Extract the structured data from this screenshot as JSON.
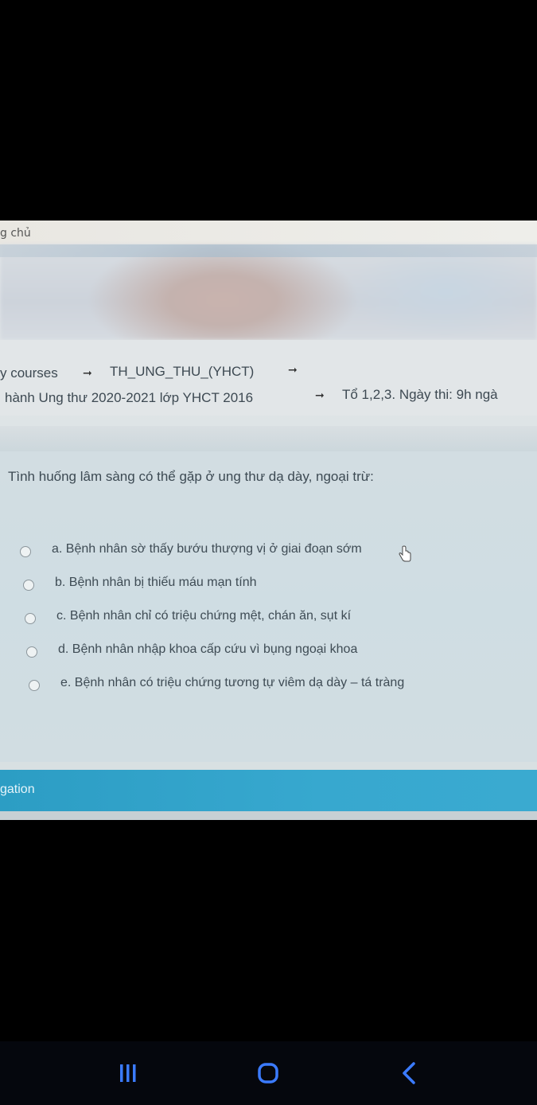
{
  "topbar": {
    "text": "g chủ"
  },
  "breadcrumb": {
    "line1": {
      "item1": "y courses",
      "item2": "TH_UNG_THU_(YHCT)"
    },
    "line2": {
      "item1": "hành Ung thư 2020-2021 lớp YHCT 2016",
      "item2": "Tổ 1,2,3. Ngày thi: 9h ngà"
    }
  },
  "question": {
    "text": "Tình huống lâm sàng có thể gặp ở ung thư dạ dày, ngoại trừ:",
    "options": [
      {
        "label": "a. Bệnh nhân sờ thấy bướu thượng vị ở giai đoạn sớm"
      },
      {
        "label": "b. Bệnh nhân bị thiếu máu mạn tính"
      },
      {
        "label": "c. Bệnh nhân chỉ có triệu chứng mệt, chán ăn, sụt kí"
      },
      {
        "label": "d. Bệnh nhân nhập khoa cấp cứu vì bụng ngoại khoa"
      },
      {
        "label": "e. Bệnh nhân có triệu chứng tương tự viêm dạ dày – tá tràng"
      }
    ]
  },
  "navigation": {
    "label": "gation"
  },
  "android_nav": {
    "recents": "recents-icon",
    "home": "home-icon",
    "back": "back-icon",
    "accent": "#3b7bff"
  }
}
